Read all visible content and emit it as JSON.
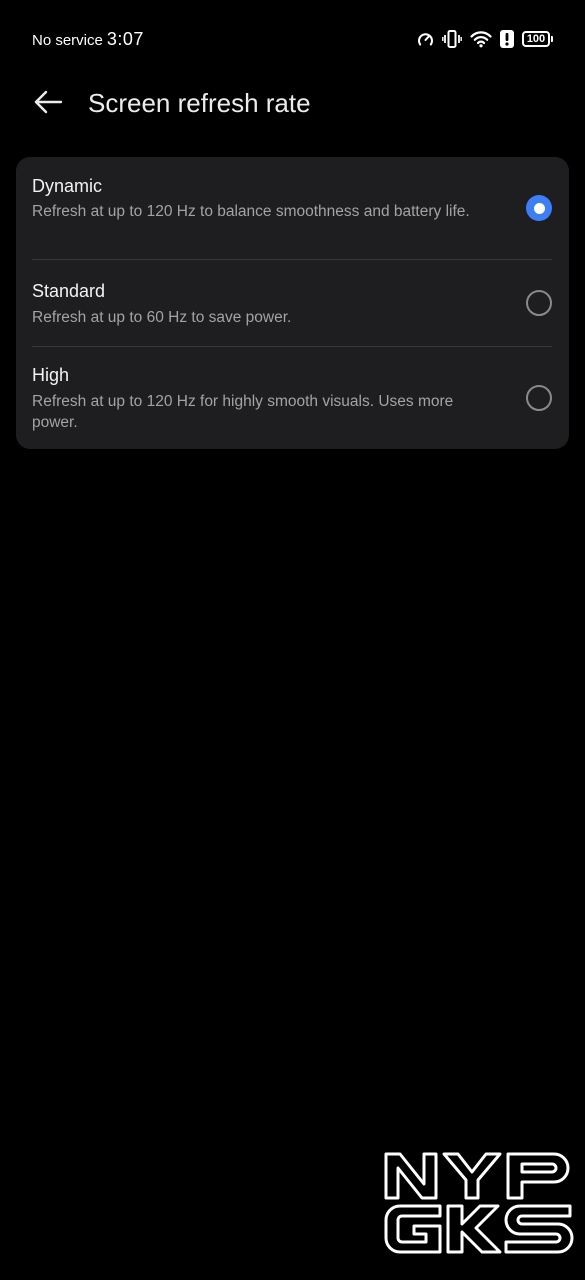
{
  "status_bar": {
    "carrier": "No service",
    "time": "3:07",
    "battery_level": "100",
    "icons": [
      "speed-meter-icon",
      "vibrate-icon",
      "wifi-icon",
      "alert-icon",
      "battery-icon"
    ]
  },
  "header": {
    "back_icon": "arrow-left-icon",
    "title": "Screen refresh rate"
  },
  "options": [
    {
      "title": "Dynamic",
      "description": "Refresh at up to 120 Hz to balance smoothness and battery life.",
      "selected": true
    },
    {
      "title": "Standard",
      "description": "Refresh at up to 60 Hz to save power.",
      "selected": false
    },
    {
      "title": "High",
      "description": "Refresh at up to 120 Hz for highly smooth visuals. Uses more power.",
      "selected": false
    }
  ],
  "watermark": {
    "text": "NYP GKS"
  },
  "colors": {
    "background": "#000000",
    "card": "#1e1e20",
    "accent": "#3d7ef5",
    "secondary_text": "#a3a3a6"
  }
}
